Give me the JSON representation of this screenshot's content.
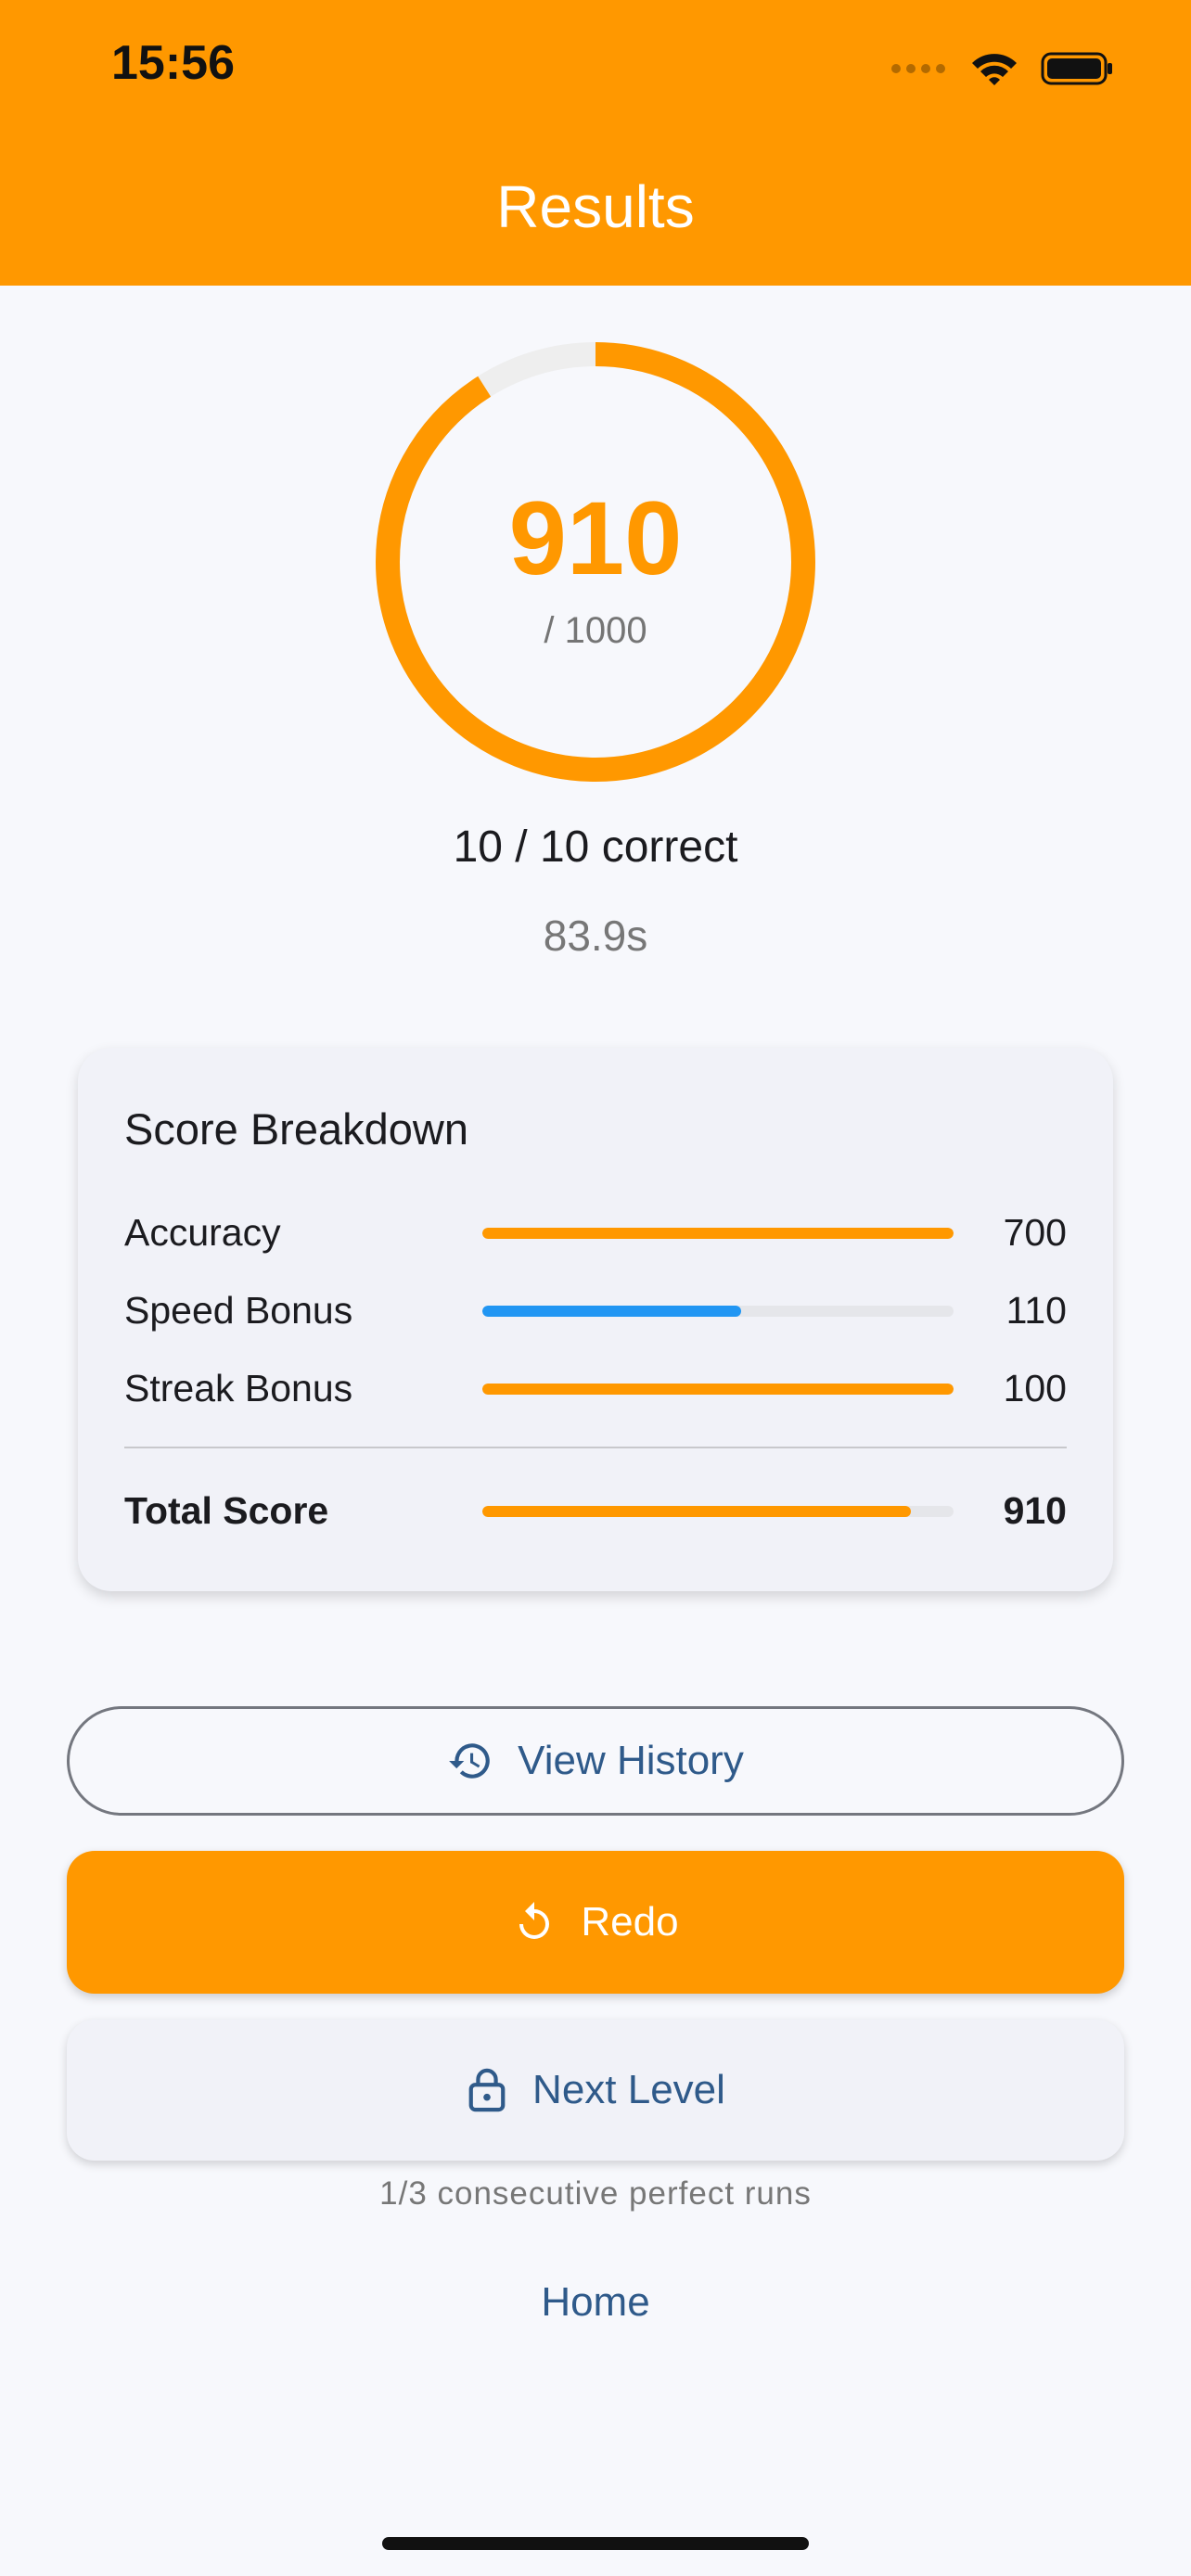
{
  "status_bar": {
    "time": "15:56"
  },
  "header": {
    "title": "Results"
  },
  "score": {
    "value": "910",
    "max_label": "/ 1000",
    "progress": 0.91
  },
  "summary": {
    "correct": "10 / 10 correct",
    "time": "83.9s"
  },
  "breakdown": {
    "title": "Score Breakdown",
    "rows": [
      {
        "label": "Accuracy",
        "value": "700",
        "fill": 1.0,
        "color": "#ff9800"
      },
      {
        "label": "Speed Bonus",
        "value": "110",
        "fill": 0.55,
        "color": "#2196f3"
      },
      {
        "label": "Streak Bonus",
        "value": "100",
        "fill": 1.0,
        "color": "#ff9800"
      }
    ],
    "total": {
      "label": "Total Score",
      "value": "910",
      "fill": 0.91,
      "color": "#ff9800"
    }
  },
  "actions": {
    "view_history": "View History",
    "redo": "Redo",
    "next_level": "Next Level",
    "streak_note": "1/3 consecutive perfect runs",
    "home": "Home"
  },
  "colors": {
    "accent": "#ff9800",
    "link": "#2f5a8a",
    "speed": "#2196f3"
  },
  "icons": [
    "history-icon",
    "redo-icon",
    "lock-icon",
    "wifi-icon",
    "battery-icon",
    "signal-icon"
  ]
}
